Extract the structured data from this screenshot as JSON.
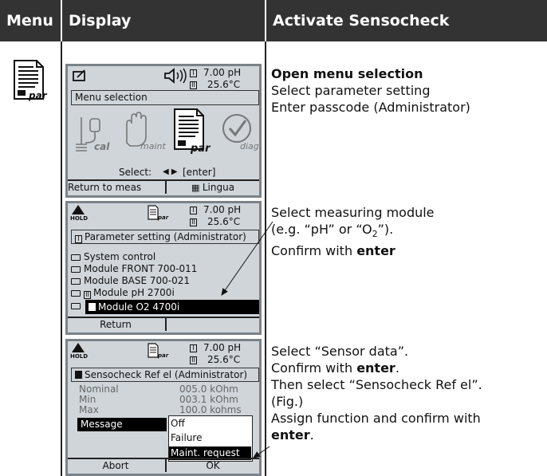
{
  "header": {
    "col_menu": "Menu",
    "col_display": "Display",
    "col_action": "Activate Sensocheck"
  },
  "screen1": {
    "reading_ph": "7.00 pH",
    "reading_temp": "25.6°C",
    "title_box": "Menu selection",
    "icons": {
      "cal": "cal",
      "maint": "maint",
      "par": "par",
      "diag": "diag"
    },
    "select_label": "Select:",
    "select_hint": "[enter]",
    "soft_left": "Return to meas",
    "soft_right": "Lingua"
  },
  "screen2": {
    "hold": "HOLD",
    "par": "par",
    "reading_ph": "7.00 pH",
    "reading_temp": "25.6°C",
    "title_box": "Parameter setting (Administrator)",
    "items": [
      "System control",
      "Module FRONT 700-011",
      "Module BASE 700-021",
      "Module pH 2700i",
      "Module O2 4700i"
    ],
    "soft_left": "Return",
    "soft_right": ""
  },
  "screen3": {
    "hold": "HOLD",
    "par": "par",
    "reading_ph": "7.00 pH",
    "reading_temp": "25.6°C",
    "title_box": "Sensocheck Ref el (Administrator)",
    "rows": [
      {
        "label": "Nominal",
        "value": "005.0 kOhm"
      },
      {
        "label": "Min",
        "value": "003.1 kOhm"
      },
      {
        "label": "Max",
        "value": "100.0 kohms"
      }
    ],
    "message_label": "Message",
    "options": [
      "Off",
      "Failure",
      "Maint. request"
    ],
    "soft_left": "Abort",
    "soft_right": "OK"
  },
  "action1": {
    "heading": "Open menu selection",
    "line1": "Select parameter setting",
    "line2": "Enter passcode (Administrator)"
  },
  "action2": {
    "line1": "Select measuring module",
    "line2_pre": "(e.g. “pH” or “O",
    "line2_sub": "2",
    "line2_post": "”).",
    "line3_pre": "Confirm with ",
    "line3_bold": "enter"
  },
  "action3": {
    "line1": "Select “Sensor data”.",
    "line2_pre": "Confirm with ",
    "line2_bold": "enter",
    "line2_post": ".",
    "line3": "Then select “Sensocheck Ref el”.",
    "line4": "(Fig.)",
    "line5": "Assign function and confirm with",
    "line6_bold": "enter",
    "line6_post": "."
  }
}
